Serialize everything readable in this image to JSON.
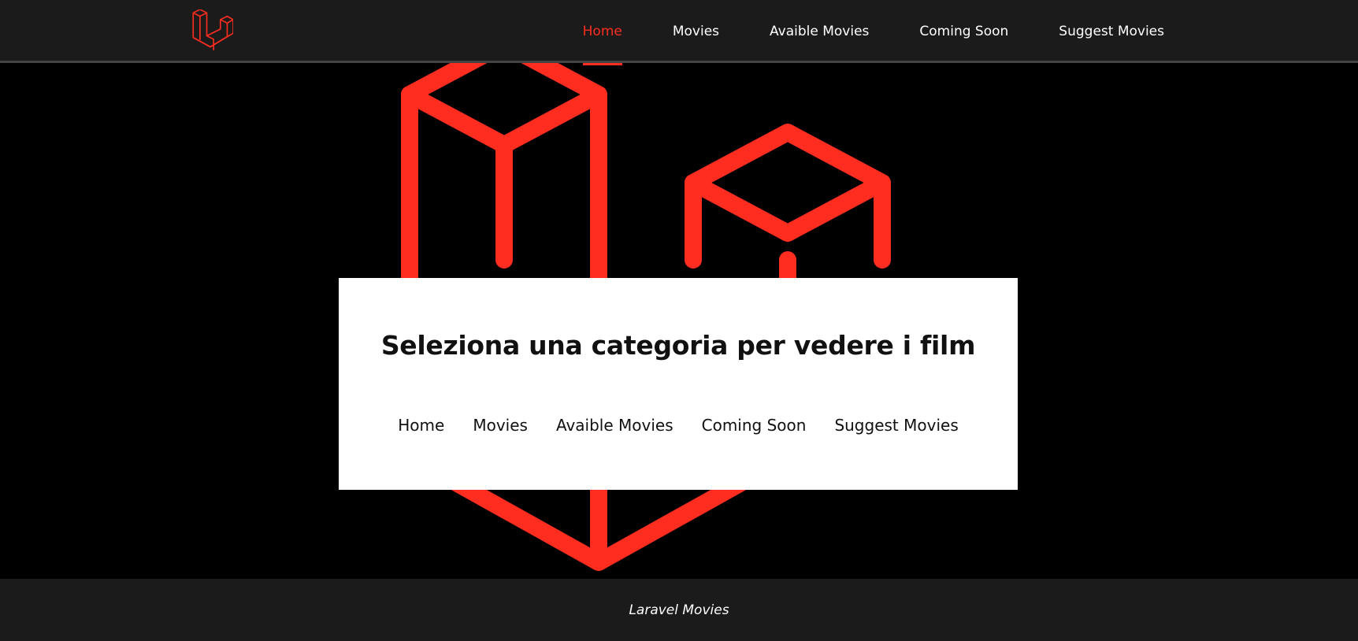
{
  "colors": {
    "accent": "#ff2d20",
    "navbar_bg": "#1b1b1b",
    "hero_bg": "#000000",
    "card_bg": "#ffffff"
  },
  "navbar": {
    "logo_icon": "laravel-logo-icon",
    "links": [
      {
        "label": "Home",
        "active": true
      },
      {
        "label": "Movies",
        "active": false
      },
      {
        "label": "Avaible Movies",
        "active": false
      },
      {
        "label": "Coming Soon",
        "active": false
      },
      {
        "label": "Suggest Movies",
        "active": false
      }
    ]
  },
  "hero": {
    "background_icon": "laravel-logo-icon",
    "card": {
      "title": "Seleziona una categoria per vedere i film",
      "links": [
        "Home",
        "Movies",
        "Avaible Movies",
        "Coming Soon",
        "Suggest Movies"
      ]
    }
  },
  "footer": {
    "text": "Laravel Movies"
  }
}
